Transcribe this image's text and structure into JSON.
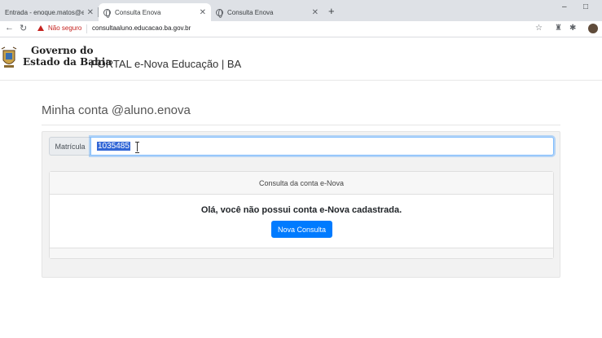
{
  "browser": {
    "tabs": [
      {
        "title": "Entrada - enoque.matos@enova",
        "active": false
      },
      {
        "title": "Consulta Enova",
        "active": true
      },
      {
        "title": "Consulta Enova",
        "active": false
      }
    ],
    "new_tab": "+",
    "window_controls": {
      "minimize": "–",
      "maximize": "□"
    },
    "nav": {
      "back": "←",
      "reload": "↻"
    },
    "security_label": "Não seguro",
    "url": "consultaaluno.educacao.ba.gov.br",
    "icons": [
      "star-icon",
      "extension-icon",
      "puzzle-icon",
      "profile-avatar"
    ]
  },
  "header": {
    "gov_line1": "Governo do",
    "gov_line2": "Estado da Bahia",
    "portal_title": "PORTAL e-Nova Educação | BA"
  },
  "main": {
    "page_title": "Minha conta @aluno.enova",
    "matricula_label": "Matrícula",
    "matricula_value": "1035485",
    "card": {
      "header": "Consulta da conta e-Nova",
      "message": "Olá, você não possui conta e-Nova cadastrada.",
      "button": "Nova Consulta"
    }
  },
  "colors": {
    "primary": "#007bff",
    "not_secure": "#c5221f",
    "selection": "#3367d6"
  }
}
